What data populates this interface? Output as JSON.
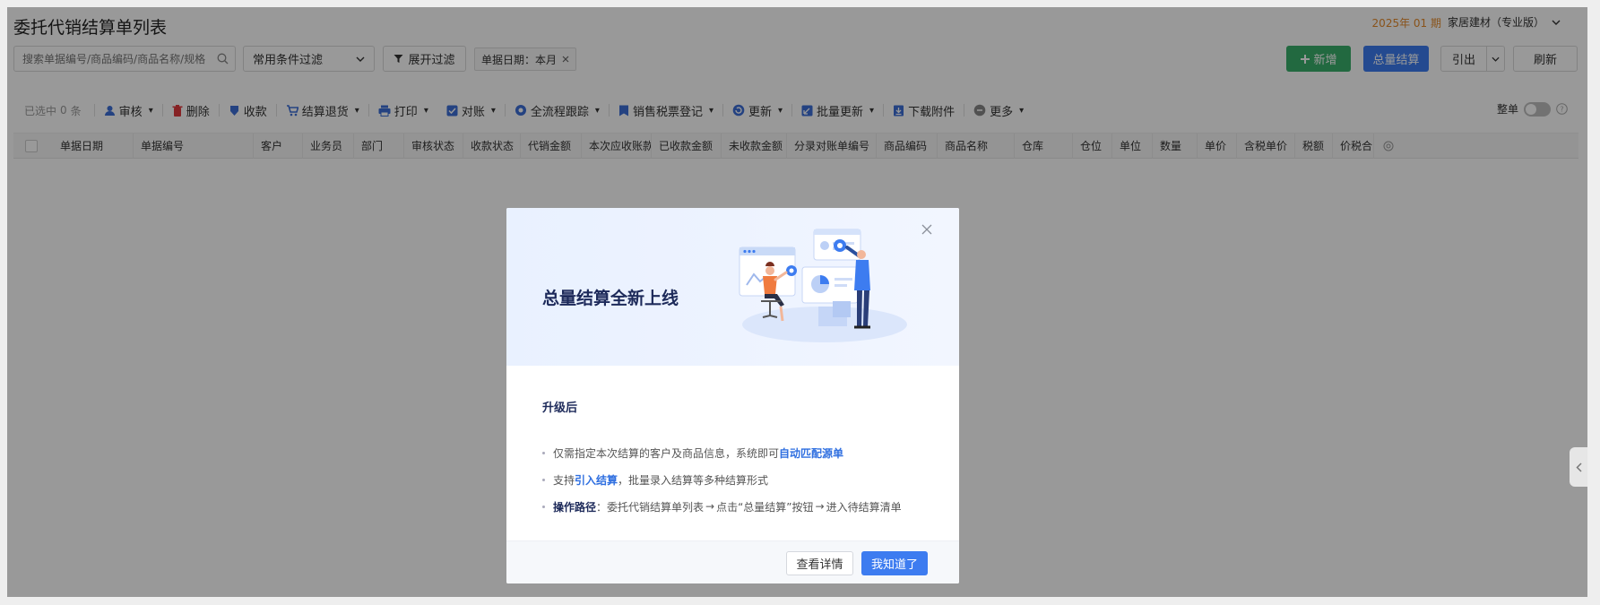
{
  "header": {
    "title": "委托代销结算单列表",
    "period": "2025年 01 期",
    "company": "家居建材（专业版）"
  },
  "filters": {
    "search_placeholder": "搜索单据编号/商品编码/商品名称/规格",
    "common_filter": "常用条件过滤",
    "expand_filter": "展开过滤",
    "date_tag": "单据日期：本月"
  },
  "actions": {
    "add": "新增",
    "total_settle": "总量结算",
    "export": "引出",
    "refresh": "刷新"
  },
  "toolbar": {
    "selected": "已选中",
    "selected_count": "0",
    "selected_unit": "条",
    "audit": "审核",
    "delete": "删除",
    "collect": "收款",
    "settle_return": "结算退货",
    "print": "打印",
    "reconcile": "对账",
    "trace": "全流程跟踪",
    "invoice": "销售税票登记",
    "update": "更新",
    "batch_update": "批量更新",
    "download": "下载附件",
    "more": "更多",
    "whole": "整单"
  },
  "columns": [
    "单据日期",
    "单据编号",
    "客户",
    "业务员",
    "部门",
    "审核状态",
    "收款状态",
    "代销金额",
    "本次应收账款",
    "已收款金额",
    "未收款金额",
    "分录对账单编号",
    "商品编码",
    "商品名称",
    "仓库",
    "仓位",
    "单位",
    "数量",
    "单价",
    "含税单价",
    "税额",
    "价税合"
  ],
  "modal": {
    "title": "总量结算全新上线",
    "subtitle": "升级后",
    "item1_text": "仅需指定本次结算的客户及商品信息，系统即可",
    "item1_link": "自动匹配源单",
    "item2_pre": "支持",
    "item2_link": "引入结算",
    "item2_post": "，批量录入结算等多种结算形式",
    "item3_bold": "操作路径",
    "item3_a": "：委托代销结算单列表",
    "item3_b": "点击“总量结算”按钮",
    "item3_c": "进入待结算清单",
    "arrow": "→",
    "detail_button": "查看详情",
    "ok_button": "我知道了"
  }
}
